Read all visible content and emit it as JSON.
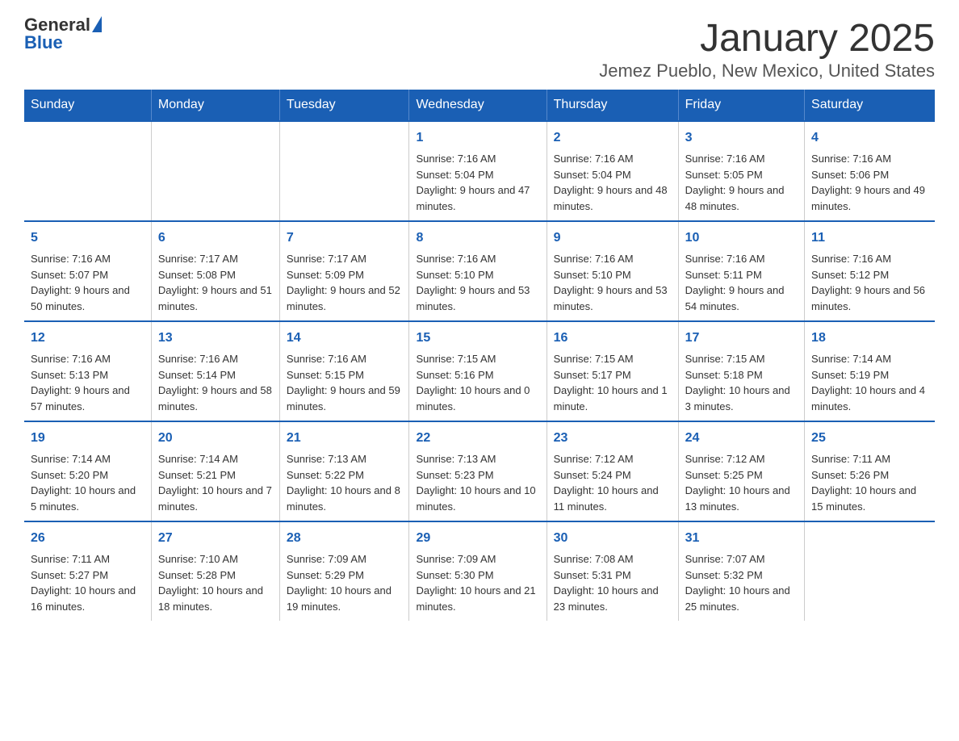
{
  "header": {
    "logo_general": "General",
    "logo_blue": "Blue",
    "title": "January 2025",
    "subtitle": "Jemez Pueblo, New Mexico, United States"
  },
  "calendar": {
    "days_of_week": [
      "Sunday",
      "Monday",
      "Tuesday",
      "Wednesday",
      "Thursday",
      "Friday",
      "Saturday"
    ],
    "weeks": [
      [
        {
          "day": "",
          "info": ""
        },
        {
          "day": "",
          "info": ""
        },
        {
          "day": "",
          "info": ""
        },
        {
          "day": "1",
          "info": "Sunrise: 7:16 AM\nSunset: 5:04 PM\nDaylight: 9 hours and 47 minutes."
        },
        {
          "day": "2",
          "info": "Sunrise: 7:16 AM\nSunset: 5:04 PM\nDaylight: 9 hours and 48 minutes."
        },
        {
          "day": "3",
          "info": "Sunrise: 7:16 AM\nSunset: 5:05 PM\nDaylight: 9 hours and 48 minutes."
        },
        {
          "day": "4",
          "info": "Sunrise: 7:16 AM\nSunset: 5:06 PM\nDaylight: 9 hours and 49 minutes."
        }
      ],
      [
        {
          "day": "5",
          "info": "Sunrise: 7:16 AM\nSunset: 5:07 PM\nDaylight: 9 hours and 50 minutes."
        },
        {
          "day": "6",
          "info": "Sunrise: 7:17 AM\nSunset: 5:08 PM\nDaylight: 9 hours and 51 minutes."
        },
        {
          "day": "7",
          "info": "Sunrise: 7:17 AM\nSunset: 5:09 PM\nDaylight: 9 hours and 52 minutes."
        },
        {
          "day": "8",
          "info": "Sunrise: 7:16 AM\nSunset: 5:10 PM\nDaylight: 9 hours and 53 minutes."
        },
        {
          "day": "9",
          "info": "Sunrise: 7:16 AM\nSunset: 5:10 PM\nDaylight: 9 hours and 53 minutes."
        },
        {
          "day": "10",
          "info": "Sunrise: 7:16 AM\nSunset: 5:11 PM\nDaylight: 9 hours and 54 minutes."
        },
        {
          "day": "11",
          "info": "Sunrise: 7:16 AM\nSunset: 5:12 PM\nDaylight: 9 hours and 56 minutes."
        }
      ],
      [
        {
          "day": "12",
          "info": "Sunrise: 7:16 AM\nSunset: 5:13 PM\nDaylight: 9 hours and 57 minutes."
        },
        {
          "day": "13",
          "info": "Sunrise: 7:16 AM\nSunset: 5:14 PM\nDaylight: 9 hours and 58 minutes."
        },
        {
          "day": "14",
          "info": "Sunrise: 7:16 AM\nSunset: 5:15 PM\nDaylight: 9 hours and 59 minutes."
        },
        {
          "day": "15",
          "info": "Sunrise: 7:15 AM\nSunset: 5:16 PM\nDaylight: 10 hours and 0 minutes."
        },
        {
          "day": "16",
          "info": "Sunrise: 7:15 AM\nSunset: 5:17 PM\nDaylight: 10 hours and 1 minute."
        },
        {
          "day": "17",
          "info": "Sunrise: 7:15 AM\nSunset: 5:18 PM\nDaylight: 10 hours and 3 minutes."
        },
        {
          "day": "18",
          "info": "Sunrise: 7:14 AM\nSunset: 5:19 PM\nDaylight: 10 hours and 4 minutes."
        }
      ],
      [
        {
          "day": "19",
          "info": "Sunrise: 7:14 AM\nSunset: 5:20 PM\nDaylight: 10 hours and 5 minutes."
        },
        {
          "day": "20",
          "info": "Sunrise: 7:14 AM\nSunset: 5:21 PM\nDaylight: 10 hours and 7 minutes."
        },
        {
          "day": "21",
          "info": "Sunrise: 7:13 AM\nSunset: 5:22 PM\nDaylight: 10 hours and 8 minutes."
        },
        {
          "day": "22",
          "info": "Sunrise: 7:13 AM\nSunset: 5:23 PM\nDaylight: 10 hours and 10 minutes."
        },
        {
          "day": "23",
          "info": "Sunrise: 7:12 AM\nSunset: 5:24 PM\nDaylight: 10 hours and 11 minutes."
        },
        {
          "day": "24",
          "info": "Sunrise: 7:12 AM\nSunset: 5:25 PM\nDaylight: 10 hours and 13 minutes."
        },
        {
          "day": "25",
          "info": "Sunrise: 7:11 AM\nSunset: 5:26 PM\nDaylight: 10 hours and 15 minutes."
        }
      ],
      [
        {
          "day": "26",
          "info": "Sunrise: 7:11 AM\nSunset: 5:27 PM\nDaylight: 10 hours and 16 minutes."
        },
        {
          "day": "27",
          "info": "Sunrise: 7:10 AM\nSunset: 5:28 PM\nDaylight: 10 hours and 18 minutes."
        },
        {
          "day": "28",
          "info": "Sunrise: 7:09 AM\nSunset: 5:29 PM\nDaylight: 10 hours and 19 minutes."
        },
        {
          "day": "29",
          "info": "Sunrise: 7:09 AM\nSunset: 5:30 PM\nDaylight: 10 hours and 21 minutes."
        },
        {
          "day": "30",
          "info": "Sunrise: 7:08 AM\nSunset: 5:31 PM\nDaylight: 10 hours and 23 minutes."
        },
        {
          "day": "31",
          "info": "Sunrise: 7:07 AM\nSunset: 5:32 PM\nDaylight: 10 hours and 25 minutes."
        },
        {
          "day": "",
          "info": ""
        }
      ]
    ]
  }
}
